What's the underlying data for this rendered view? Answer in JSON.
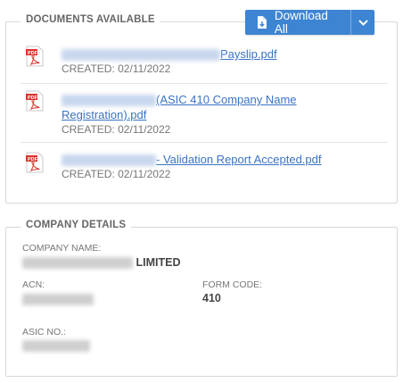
{
  "documents": {
    "title": "DOCUMENTS AVAILABLE",
    "download_button": {
      "label": "Download All",
      "icon": "download-file-icon",
      "caret": "chevron-down-icon"
    },
    "items": [
      {
        "name": "Payslip.pdf",
        "created": "CREATED: 02/11/2022"
      },
      {
        "name_line1": "(ASIC 410 Company Name",
        "name_line2": "Registration).pdf",
        "created": "CREATED: 02/11/2022"
      },
      {
        "name": "- Validation Report Accepted.pdf",
        "created": "CREATED: 02/11/2022"
      }
    ]
  },
  "company": {
    "title": "COMPANY DETAILS",
    "name_label": "COMPANY NAME:",
    "name_value": "LIMITED",
    "acn_label": "ACN:",
    "form_code_label": "FORM CODE:",
    "form_code_value": "410",
    "asic_label": "ASIC NO.:"
  },
  "colors": {
    "accent": "#3d85d3",
    "link": "#3a73c4",
    "pdf_red": "#d6352b"
  }
}
